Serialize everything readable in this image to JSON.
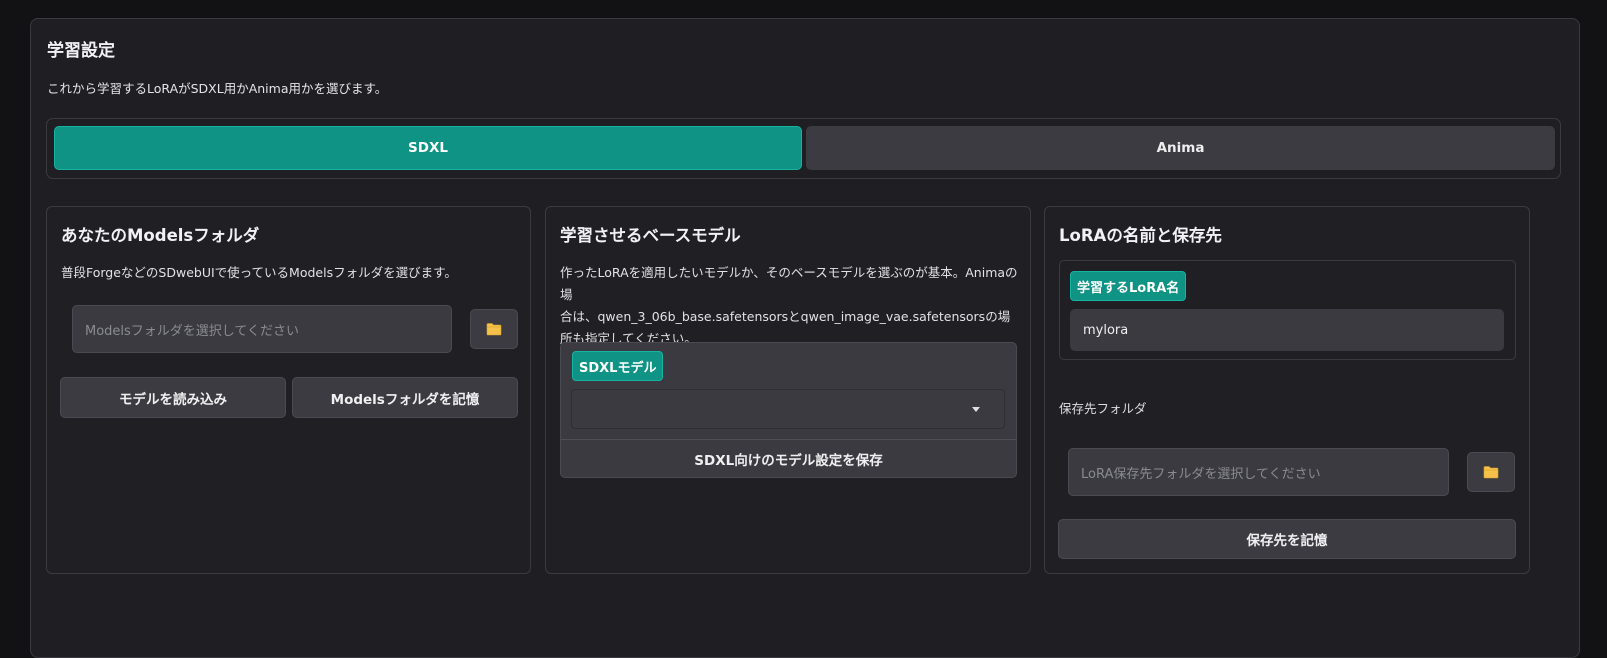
{
  "section": {
    "title": "学習設定",
    "description": "これから学習するLoRAがSDXL用かAnima用かを選びます。"
  },
  "model_type_toggle": {
    "options": [
      "SDXL",
      "Anima"
    ],
    "selected": "SDXL"
  },
  "models_folder_panel": {
    "title": "あなたのModelsフォルダ",
    "description": "普段ForgeなどのSDwebUIで使っているModelsフォルダを選びます。",
    "folder_input_placeholder": "Modelsフォルダを選択してください",
    "folder_input_value": "",
    "browse_icon": "folder-icon",
    "load_models_label": "モデルを読み込み",
    "remember_folder_label": "Modelsフォルダを記憶"
  },
  "base_model_panel": {
    "title": "学習させるベースモデル",
    "description_lines": [
      "作ったLoRAを適用したいモデルか、そのベースモデルを選ぶのが基本。Animaの場",
      "合は、qwen_3_06b_base.safetensorsとqwen_image_vae.safetensorsの場",
      "所も指定してください。"
    ],
    "model_select_label": "SDXLモデル",
    "model_select_value": "",
    "save_settings_label": "SDXL向けのモデル設定を保存"
  },
  "lora_output_panel": {
    "title": "LoRAの名前と保存先",
    "lora_name_label": "学習するLoRA名",
    "lora_name_value": "mylora",
    "save_folder_label": "保存先フォルダ",
    "save_folder_placeholder": "LoRA保存先フォルダを選択してください",
    "browse_icon": "folder-icon",
    "remember_save_label": "保存先を記憶"
  },
  "colors": {
    "accent": "#0e9385",
    "accent_border": "#17b3a2",
    "panel_bg": "#202024",
    "input_bg": "#3a3a40",
    "folder_icon": "#f5c14b"
  }
}
